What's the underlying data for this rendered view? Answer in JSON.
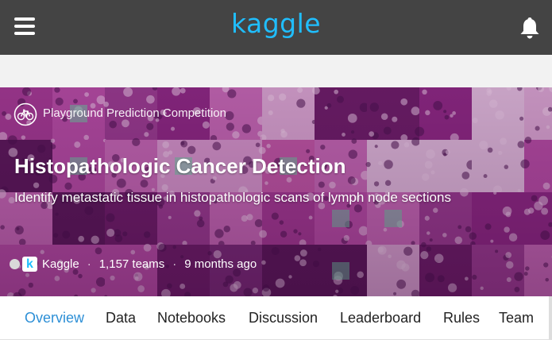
{
  "header": {
    "logo_text": "kaggle",
    "icons": [
      "menu-icon",
      "bell-icon"
    ]
  },
  "competition": {
    "type_icon": "bicycle-icon",
    "type_label": "Playground Prediction Competition",
    "title": "Histopathologic Cancer Detection",
    "subtitle": "Identify metastatic tissue in histopathologic scans of lymph node sections",
    "host": "Kaggle",
    "host_logo_letter": "k",
    "teams": "1,157 teams",
    "time_ago": "9 months ago",
    "separator": "·"
  },
  "tabs": [
    {
      "label": "Overview",
      "active": true
    },
    {
      "label": "Data",
      "active": false
    },
    {
      "label": "Notebooks",
      "active": false
    },
    {
      "label": "Discussion",
      "active": false
    },
    {
      "label": "Leaderboard",
      "active": false
    },
    {
      "label": "Rules",
      "active": false
    },
    {
      "label": "Team",
      "active": false
    }
  ],
  "colors": {
    "topbar": "#444444",
    "brand": "#20BEFF",
    "active_tab": "#2d8fd6"
  }
}
